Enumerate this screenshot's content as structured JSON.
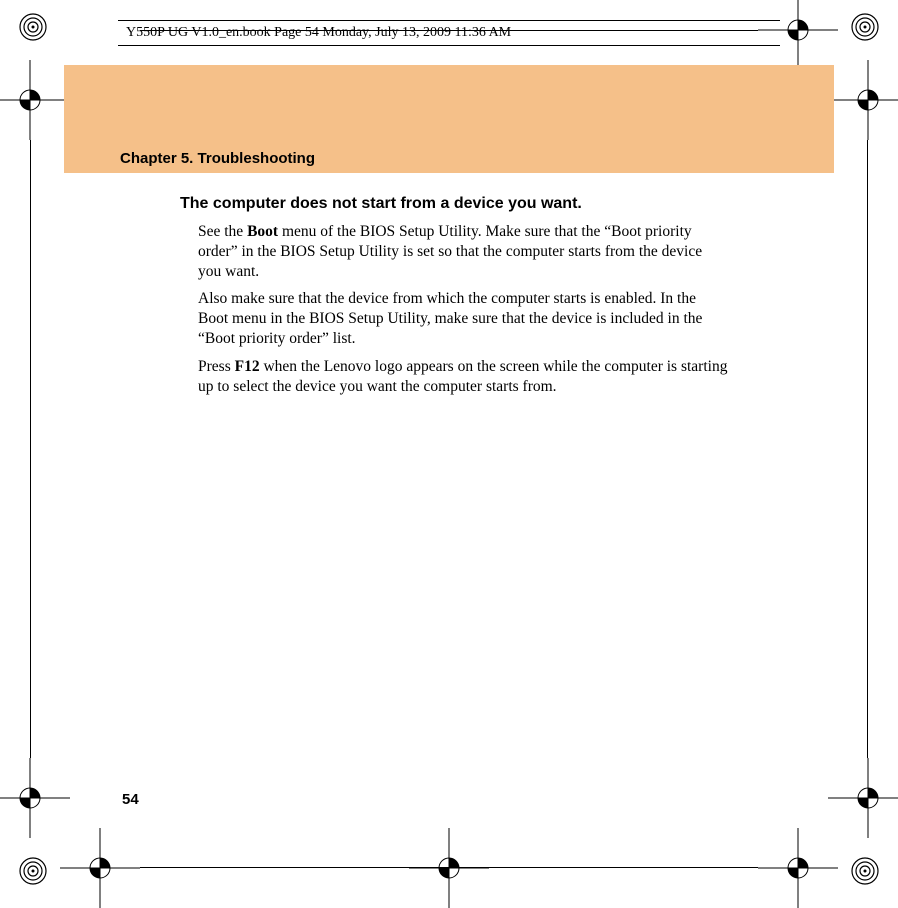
{
  "meta": {
    "header_line": "Y550P UG V1.0_en.book  Page 54  Monday, July 13, 2009  11:36 AM"
  },
  "chapter": {
    "title": "Chapter 5. Troubleshooting"
  },
  "topic": {
    "heading": "The computer does not start from a device you want."
  },
  "body": {
    "p1_a": "See the ",
    "p1_bold": "Boot",
    "p1_b": " menu of the BIOS Setup Utility. Make sure that the “Boot priority order” in the BIOS Setup Utility is set so that the computer starts from the device you want.",
    "p2": "Also make sure that the device from which the computer starts is enabled. In the Boot menu in the BIOS Setup Utility, make sure that the device is included in the “Boot priority order” list.",
    "p3_a": "Press ",
    "p3_bold": "F12",
    "p3_b": " when the Lenovo logo appears on the screen while the computer is starting up to select the device you want the computer starts from."
  },
  "page_number": "54"
}
